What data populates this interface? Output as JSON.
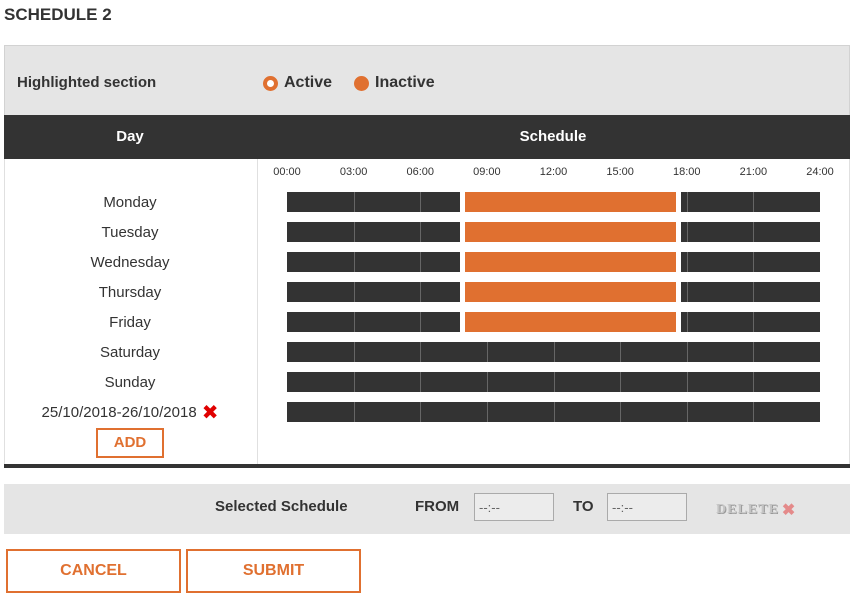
{
  "page": {
    "title": "SCHEDULE 2"
  },
  "legend": {
    "label": "Highlighted section",
    "active": "Active",
    "inactive": "Inactive",
    "accent_color": "#e07030"
  },
  "table": {
    "day_header": "Day",
    "schedule_header": "Schedule",
    "time_ticks": [
      "00:00",
      "03:00",
      "06:00",
      "09:00",
      "12:00",
      "15:00",
      "18:00",
      "21:00",
      "24:00"
    ],
    "rows": [
      {
        "day": "Monday",
        "active_range": [
          "08:00",
          "17:30"
        ]
      },
      {
        "day": "Tuesday",
        "active_range": [
          "08:00",
          "17:30"
        ]
      },
      {
        "day": "Wednesday",
        "active_range": [
          "08:00",
          "17:30"
        ]
      },
      {
        "day": "Thursday",
        "active_range": [
          "08:00",
          "17:30"
        ]
      },
      {
        "day": "Friday",
        "active_range": [
          "08:00",
          "17:30"
        ]
      },
      {
        "day": "Saturday",
        "active_range": null
      },
      {
        "day": "Sunday",
        "active_range": null
      },
      {
        "day": "25/10/2018-26/10/2018",
        "active_range": null,
        "removable": true
      }
    ],
    "add_label": "ADD"
  },
  "selected": {
    "label": "Selected Schedule",
    "from_label": "FROM",
    "from_placeholder": "--:--",
    "to_label": "TO",
    "to_placeholder": "--:--",
    "delete_label": "DELETE"
  },
  "actions": {
    "cancel_label": "CANCEL",
    "submit_label": "SUBMIT"
  }
}
